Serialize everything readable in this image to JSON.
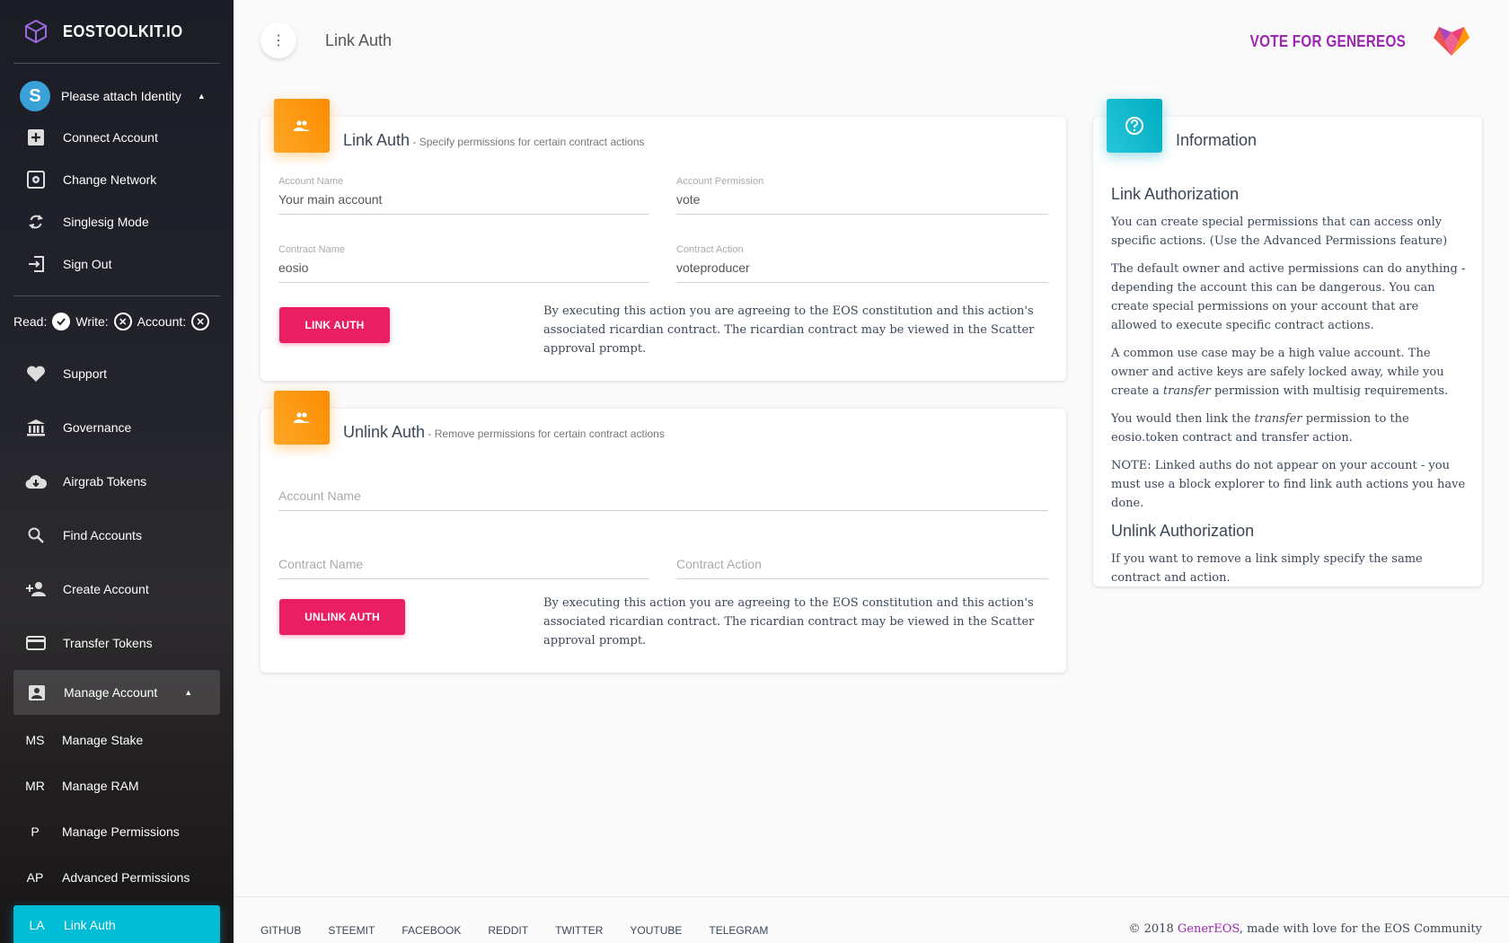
{
  "sidebar": {
    "brand": "EOSTOOLKIT.IO",
    "identity": "Please attach Identity",
    "identity_items": [
      {
        "label": "Connect Account",
        "icon": "plus-box-icon"
      },
      {
        "label": "Change Network",
        "icon": "network-icon"
      },
      {
        "label": "Singlesig Mode",
        "icon": "cycle-icon"
      },
      {
        "label": "Sign Out",
        "icon": "sign-out-icon"
      }
    ],
    "rwa": {
      "read": "Read:",
      "write": "Write:",
      "account": "Account:"
    },
    "items": [
      {
        "label": "Support",
        "icon": "heart-icon"
      },
      {
        "label": "Governance",
        "icon": "bank-icon"
      },
      {
        "label": "Airgrab Tokens",
        "icon": "cloud-download-icon"
      },
      {
        "label": "Find Accounts",
        "icon": "search-icon"
      },
      {
        "label": "Create Account",
        "icon": "person-add-icon"
      },
      {
        "label": "Transfer Tokens",
        "icon": "card-icon"
      }
    ],
    "manage": "Manage Account",
    "sub_items": [
      {
        "abbr": "MS",
        "label": "Manage Stake"
      },
      {
        "abbr": "MR",
        "label": "Manage RAM"
      },
      {
        "abbr": "P",
        "label": "Manage Permissions"
      },
      {
        "abbr": "AP",
        "label": "Advanced Permissions"
      },
      {
        "abbr": "LA",
        "label": "Link Auth"
      }
    ]
  },
  "header": {
    "title": "Link Auth",
    "vote": "VOTE FOR GENEREOS"
  },
  "link_card": {
    "title": "Link Auth",
    "subtitle": " - Specify permissions for certain contract actions",
    "fields": {
      "account_name": {
        "label": "Account Name",
        "value": "Your main account"
      },
      "account_permission": {
        "label": "Account Permission",
        "value": "vote"
      },
      "contract_name": {
        "label": "Contract Name",
        "value": "eosio"
      },
      "contract_action": {
        "label": "Contract Action",
        "value": "voteproducer"
      }
    },
    "button": "LINK AUTH",
    "disclaimer": "By executing this action you are agreeing to the EOS constitution and this action's associated ricardian contract. The ricardian contract may be viewed in the Scatter approval prompt."
  },
  "unlink_card": {
    "title": "Unlink Auth",
    "subtitle": " - Remove permissions for certain contract actions",
    "fields": {
      "account_name": {
        "placeholder": "Account Name"
      },
      "contract_name": {
        "placeholder": "Contract Name"
      },
      "contract_action": {
        "placeholder": "Contract Action"
      }
    },
    "button": "UNLINK AUTH",
    "disclaimer": "By executing this action you are agreeing to the EOS constitution and this action's associated ricardian contract. The ricardian contract may be viewed in the Scatter approval prompt."
  },
  "info_card": {
    "title": "Information",
    "h1": "Link Authorization",
    "p1": "You can create special permissions that can access only specific actions. (Use the Advanced Permissions feature)",
    "p2": "The default owner and active permissions can do anything - depending the account this can be dangerous. You can create special permissions on your account that are allowed to execute specific contract actions.",
    "p3a": "A common use case may be a high value account. The owner and active keys are safely locked away, while you create a ",
    "p3em": "transfer",
    "p3b": " permission with multisig requirements.",
    "p4a": "You would then link the ",
    "p4em": "transfer",
    "p4b": " permission to the eosio.token contract and transfer action.",
    "p5": "NOTE: Linked auths do not appear on your account - you must use a block explorer to find link auth actions you have done.",
    "h2": "Unlink Authorization",
    "p6": "If you want to remove a link simply specify the same contract and action."
  },
  "footer": {
    "links": [
      "GITHUB",
      "STEEMIT",
      "FACEBOOK",
      "REDDIT",
      "TWITTER",
      "YOUTUBE",
      "TELEGRAM"
    ],
    "copy_pre": "© 2018 ",
    "copy_link": "GenerEOS",
    "copy_post": ", made with love for the EOS Community"
  },
  "colors": {
    "accent": "#00bcd4",
    "button": "#e91e63",
    "orange": "#ff9800",
    "vote": "#9c27b0"
  }
}
